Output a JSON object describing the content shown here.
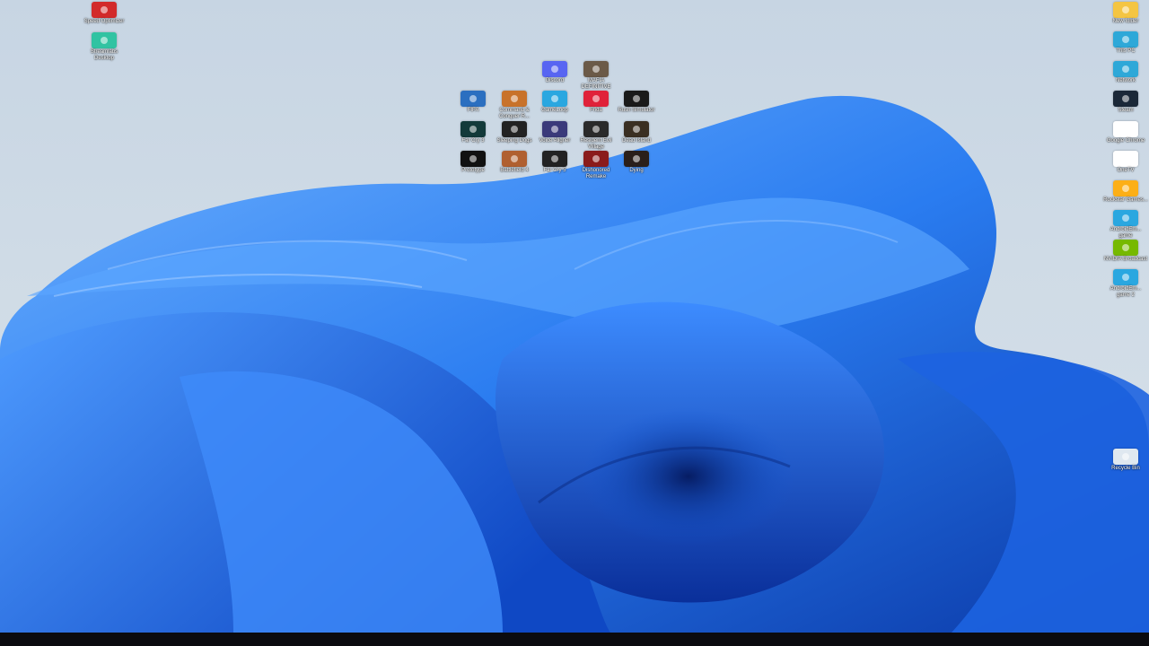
{
  "desktop": {
    "left_icons": [
      {
        "label": "Speed Optimizer",
        "icon": "speed-optimizer-icon",
        "color": "#d22a2a"
      },
      {
        "label": "Streamlabs Desktop",
        "icon": "streamlabs-icon",
        "color": "#31c3a2"
      }
    ],
    "center_icons": [
      {
        "label": "Discord",
        "icon": "discord-icon",
        "color": "#5865f2"
      },
      {
        "label": "MAFIA DEFINITIVE",
        "icon": "mafia-icon",
        "color": "#6b5a48"
      },
      {
        "label": "FIFA",
        "icon": "fifa-icon",
        "color": "#2b6fc0"
      },
      {
        "label": "Command & Conquer R...",
        "icon": "command-conquer-icon",
        "color": "#c8722a"
      },
      {
        "label": "GameLoop",
        "icon": "gameloop-icon",
        "color": "#2aa7e0"
      },
      {
        "label": "Frida",
        "icon": "frida-icon",
        "color": "#e0223a"
      },
      {
        "label": "Rush Simulator",
        "icon": "r2-icon",
        "color": "#1a1a1a"
      },
      {
        "label": "Far Cry 3",
        "icon": "farcry3-icon",
        "color": "#133a3a"
      },
      {
        "label": "Sleeping Dogs",
        "icon": "sleeping-dogs-icon",
        "color": "#222222"
      },
      {
        "label": "Voice Aligner",
        "icon": "voice-aligner-icon",
        "color": "#3a3a7a"
      },
      {
        "label": "Resident Evil Village",
        "icon": "resident-evil-icon",
        "color": "#2a2a2a"
      },
      {
        "label": "Dead Island",
        "icon": "dead-island-icon",
        "color": "#3a2f22"
      },
      {
        "label": "Prototype",
        "icon": "prototype-icon",
        "color": "#111111"
      },
      {
        "label": "Battlefield 4",
        "icon": "battlefield-icon",
        "color": "#b06030"
      },
      {
        "label": "Far Cry 5",
        "icon": "farcry5-icon",
        "color": "#222222"
      },
      {
        "label": "Dishonored Remake",
        "icon": "dishonored-icon",
        "color": "#8a1b1b"
      },
      {
        "label": "Dying",
        "icon": "dying-icon",
        "color": "#2a1f1a"
      }
    ],
    "right_icons": [
      {
        "label": "New folder",
        "icon": "folder-icon",
        "color": "#f4c542"
      },
      {
        "label": "This PC",
        "icon": "monitor-icon",
        "color": "#2ea8d8"
      },
      {
        "label": "Network",
        "icon": "network-icon",
        "color": "#2ea8d8"
      },
      {
        "label": "Steam",
        "icon": "steam-icon",
        "color": "#1b2838"
      },
      {
        "label": "Google Chrome",
        "icon": "chrome-icon",
        "color": "#ffffff"
      },
      {
        "label": "OneTV",
        "icon": "onetv-icon",
        "color": "#ffffff"
      },
      {
        "label": "Rockstar Games...",
        "icon": "rockstar-icon",
        "color": "#fcaf17"
      },
      {
        "label": "AndroidEm... game",
        "icon": "android-emulator-icon",
        "color": "#2aa7e0"
      },
      {
        "label": "NVIDIA Broadcast",
        "icon": "nvidia-icon",
        "color": "#76b900"
      },
      {
        "label": "AndroidEm... game 2",
        "icon": "android-emulator-icon",
        "color": "#2aa7e0"
      },
      {
        "label": "Recycle Bin",
        "icon": "recycle-bin-icon",
        "color": "#dfe8f0"
      }
    ]
  },
  "wallpaper": {
    "name": "windows-bloom-wallpaper",
    "colors": [
      "#0a2f9a",
      "#1257d6",
      "#2c7cf2",
      "#5aa6ff",
      "#c7d5e3"
    ]
  }
}
